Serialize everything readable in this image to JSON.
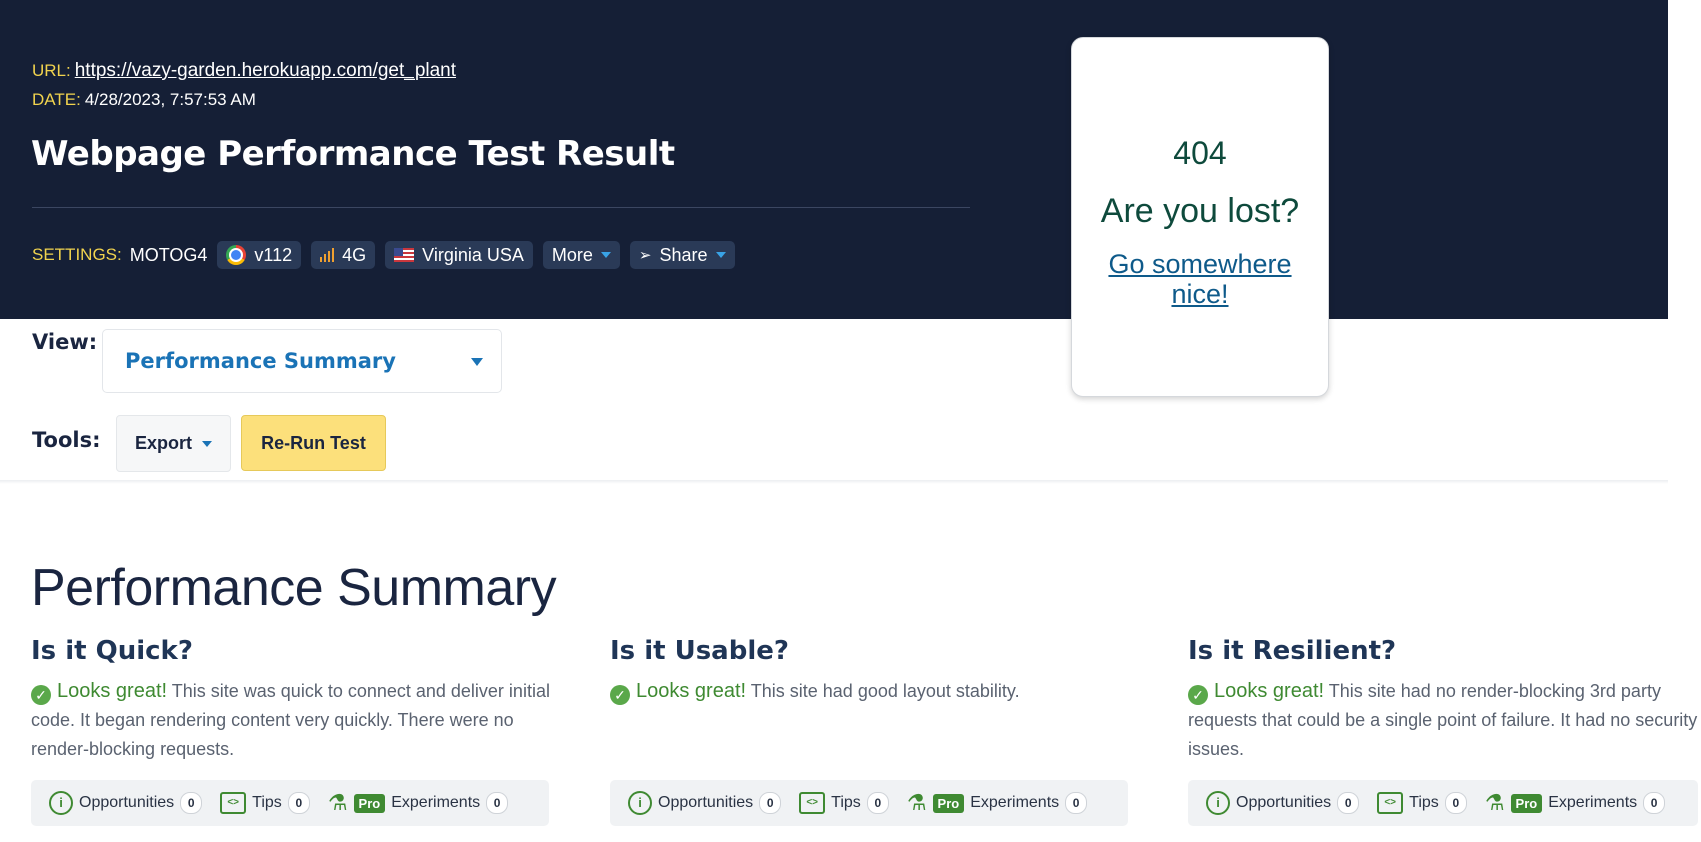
{
  "header": {
    "url_label": "URL:",
    "url": "https://vazy-garden.herokuapp.com/get_plant",
    "date_label": "DATE:",
    "date": "4/28/2023, 7:57:53 AM",
    "title": "Webpage Performance Test Result",
    "settings_label": "SETTINGS:",
    "device": "MOTOG4",
    "browser_version": "v112",
    "connection": "4G",
    "location": "Virginia USA",
    "more_label": "More",
    "share_label": "Share"
  },
  "view": {
    "label": "View:",
    "selected": "Performance Summary"
  },
  "tools": {
    "label": "Tools:",
    "export_label": "Export",
    "rerun_label": "Re-Run Test"
  },
  "overlay": {
    "code": "404",
    "message": "Are you lost?",
    "link": "Go somewhere nice!"
  },
  "summary": {
    "title": "Performance Summary",
    "columns": [
      {
        "heading": "Is it Quick?",
        "status": "Looks great!",
        "text": "This site was quick to connect and deliver initial code. It began rendering content very quickly. There were no render-blocking requests.",
        "opportunities_label": "Opportunities",
        "opportunities": "0",
        "tips_label": "Tips",
        "tips": "0",
        "pro_label": "Pro",
        "experiments_label": "Experiments",
        "experiments": "0"
      },
      {
        "heading": "Is it Usable?",
        "status": "Looks great!",
        "text": "This site had good layout stability.",
        "opportunities_label": "Opportunities",
        "opportunities": "0",
        "tips_label": "Tips",
        "tips": "0",
        "pro_label": "Pro",
        "experiments_label": "Experiments",
        "experiments": "0"
      },
      {
        "heading": "Is it Resilient?",
        "status": "Looks great!",
        "text": "This site had no render-blocking 3rd party requests that could be a single point of failure. It had no security issues.",
        "opportunities_label": "Opportunities",
        "opportunities": "0",
        "tips_label": "Tips",
        "tips": "0",
        "pro_label": "Pro",
        "experiments_label": "Experiments",
        "experiments": "0"
      }
    ]
  },
  "colors": {
    "header_bg": "#151f36",
    "accent_yellow": "#f1d34e",
    "link_blue": "#1a73b6",
    "good_green": "#3f8a32"
  }
}
